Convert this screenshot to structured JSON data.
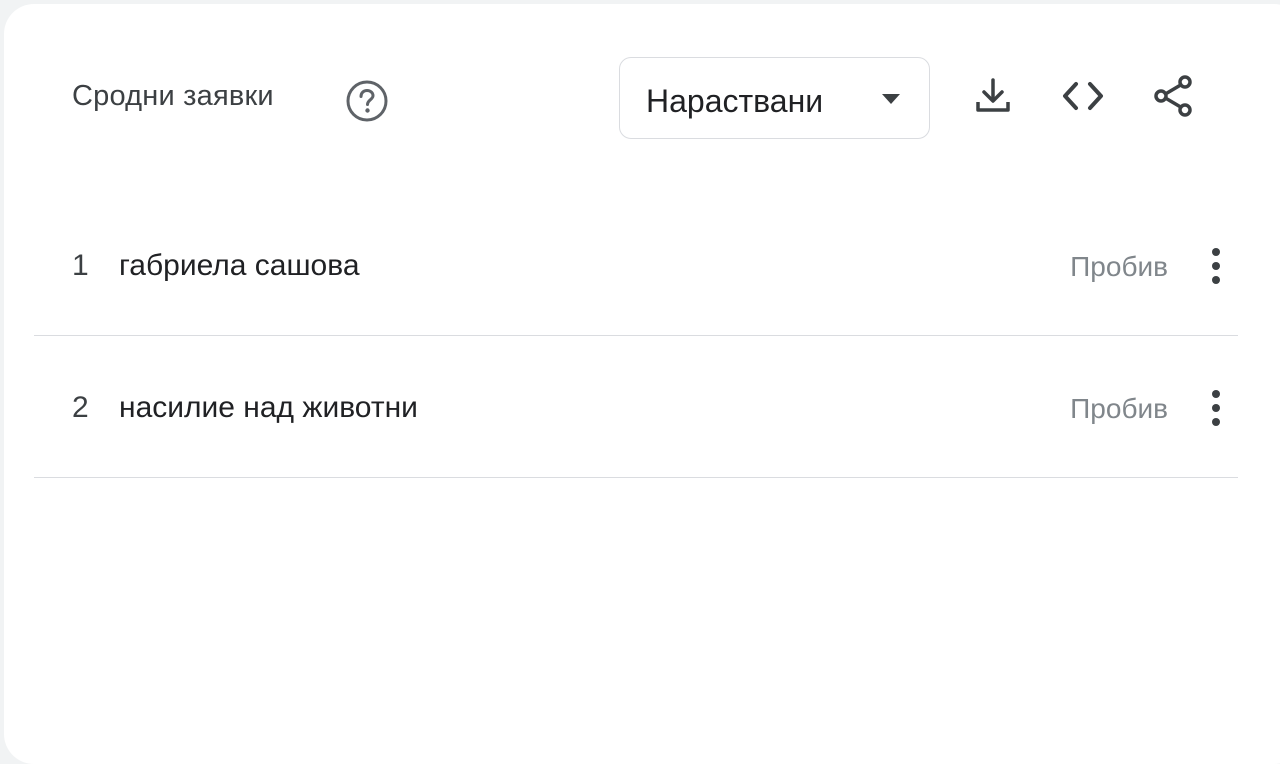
{
  "widget": {
    "title": "Сродни заявки",
    "help_icon": "help-circle-icon",
    "sort_dropdown": {
      "selected": "Нараствани",
      "icon": "caret-down-icon"
    },
    "toolbar": {
      "download_icon": "download-icon",
      "embed_icon": "code-embed-icon",
      "share_icon": "share-icon"
    }
  },
  "queries": [
    {
      "rank": "1",
      "text": "габриела сашова",
      "value": "Пробив",
      "menu_icon": "more-vert-icon"
    },
    {
      "rank": "2",
      "text": "насилие над животни",
      "value": "Пробив",
      "menu_icon": "more-vert-icon"
    }
  ],
  "colors": {
    "text_primary": "#202124",
    "text_secondary": "#80868b",
    "icon": "#5f6368",
    "divider": "#dadce0",
    "background": "#f1f3f4",
    "card": "#ffffff"
  }
}
